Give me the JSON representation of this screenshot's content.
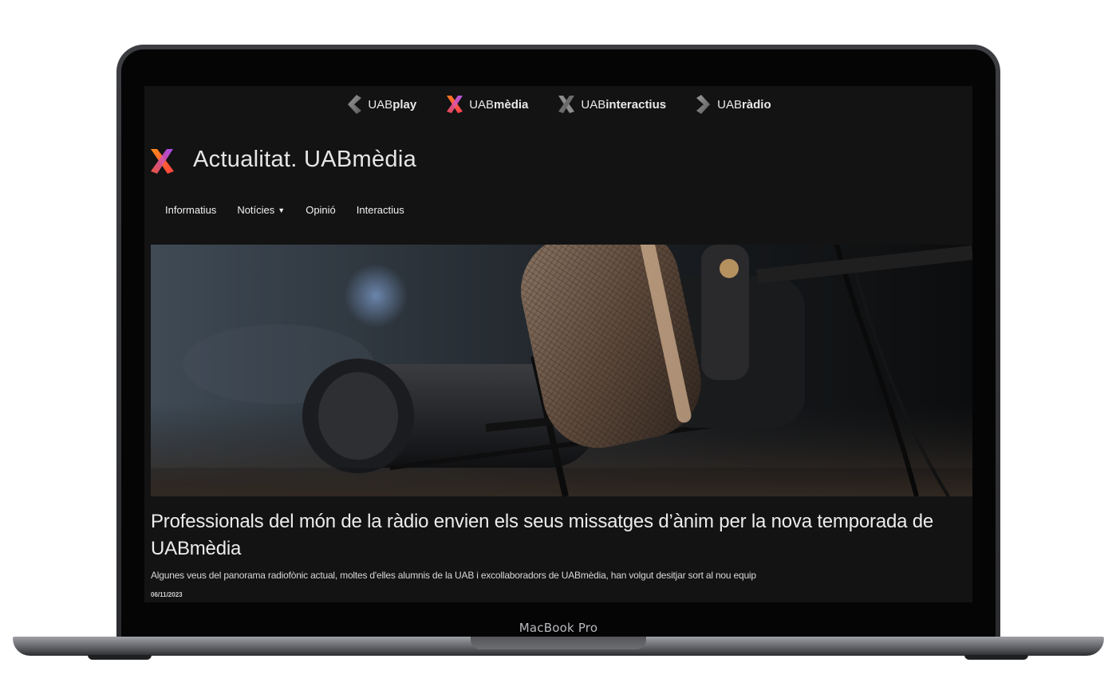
{
  "device": {
    "label": "MacBook Pro"
  },
  "topnav": {
    "brands": [
      {
        "prefix": "UAB",
        "suffix": "play",
        "icon": "uabplay-chevron-icon"
      },
      {
        "prefix": "UAB",
        "suffix": "mèdia",
        "icon": "uabmedia-x-icon"
      },
      {
        "prefix": "UAB",
        "suffix": "interactius",
        "icon": "uabinteractius-x-icon"
      },
      {
        "prefix": "UAB",
        "suffix": "ràdio",
        "icon": "uabradio-chevron-icon"
      }
    ]
  },
  "header": {
    "title": "Actualitat. UABmèdia",
    "logo_icon": "uabmedia-logo-icon"
  },
  "menu": {
    "items": [
      "Informatius",
      "Notícies",
      "Opinió",
      "Interactius"
    ]
  },
  "article": {
    "image": "microphone-photo",
    "headline": "Professionals del món de la ràdio envien els seus missatges d’ànim per la nova temporada de UABmèdia",
    "summary": "Algunes veus del panorama radiofònic actual, moltes d'elles alumnis de la UAB i excollaboradors de UABmèdia, han volgut desitjar sort al nou equip",
    "date": "06/11/2023"
  },
  "colors": {
    "screen_bg": "#131313",
    "brand_orange": "#ff6a1f",
    "brand_purple": "#8a3cf0",
    "text": "#ececec"
  }
}
